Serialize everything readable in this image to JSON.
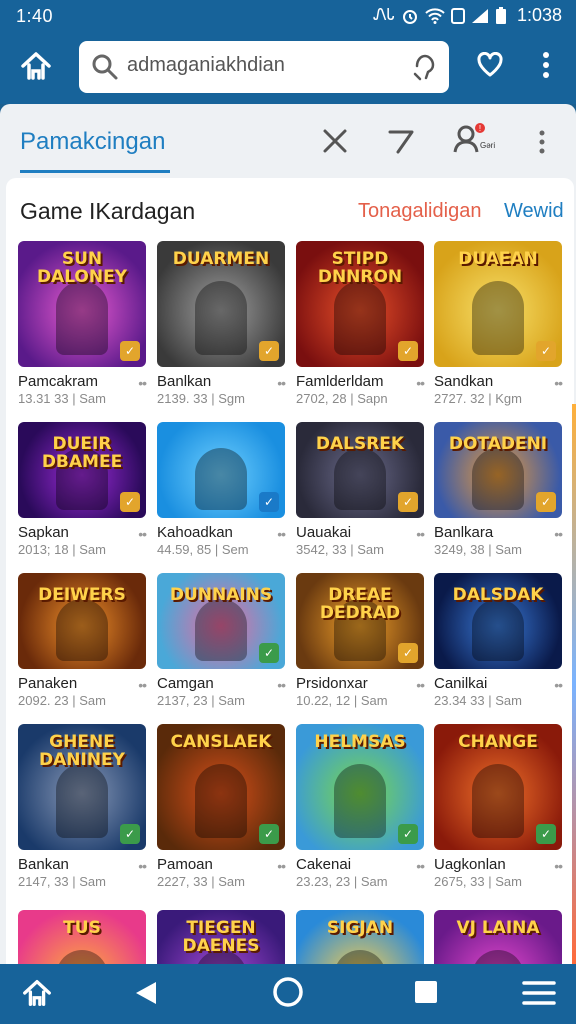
{
  "status_bar": {
    "time": "1:40",
    "carrier": "ᏁᏓ",
    "clock_right": "1:038"
  },
  "search": {
    "value": "admaganiakhdian",
    "placeholder": "admaganiakhdian"
  },
  "tabs": {
    "active_label": "Pamakcingan",
    "profile_caption": "Gəri"
  },
  "section": {
    "title": "Game IKardagan",
    "link_primary": "Tonagalidigan",
    "link_secondary": "Wewid"
  },
  "games": [
    {
      "name": "Pamcakram",
      "meta": "13.31 33 | Sam",
      "logo": "SUN DALONEY",
      "c1": "#5a1a8a",
      "c2": "#e85bd0",
      "badge": "gold"
    },
    {
      "name": "Banlkan",
      "meta": "2139. 33 | Sgm",
      "logo": "DUARMEN",
      "c1": "#3a3a3a",
      "c2": "#a0a0a0",
      "badge": "gold"
    },
    {
      "name": "Famlderldam",
      "meta": "2702, 28 | Sapn",
      "logo": "STIPD DNNRON",
      "c1": "#7a0f0f",
      "c2": "#e8502a",
      "badge": "gold"
    },
    {
      "name": "Sandkan",
      "meta": "2727. 32 | Kgm",
      "logo": "DUAEAN",
      "c1": "#d8a31a",
      "c2": "#f8e06a",
      "badge": "gold"
    },
    {
      "name": "Sapkan",
      "meta": "2013; 18 | Sam",
      "logo": "DUEIR DBAMEE",
      "c1": "#2a0a5a",
      "c2": "#9b2bd8",
      "badge": "gold"
    },
    {
      "name": "Kahoadkan",
      "meta": "44.59, 85 | Sem",
      "logo": "",
      "c1": "#1a8fe0",
      "c2": "#6fd0ff",
      "badge": "blue"
    },
    {
      "name": "Uauakai",
      "meta": "3542, 33 | Sam",
      "logo": "DALSREK",
      "c1": "#2a2a3a",
      "c2": "#6a6a8a",
      "badge": "gold"
    },
    {
      "name": "Banlkara",
      "meta": "3249, 38 | Sam",
      "logo": "DOTADENI",
      "c1": "#3a5aa8",
      "c2": "#e89a3a",
      "badge": "gold"
    },
    {
      "name": "Panaken",
      "meta": "2092. 23 | Sam",
      "logo": "DEIWERS",
      "c1": "#6a2a0a",
      "c2": "#f0902a",
      "badge": "none"
    },
    {
      "name": "Camgan",
      "meta": "2137, 23 | Sam",
      "logo": "DUNNAINS",
      "c1": "#4aa8d8",
      "c2": "#e86aa0",
      "badge": "green"
    },
    {
      "name": "Prsidonxar",
      "meta": "10.22, 12 | Sam",
      "logo": "DREAE DEDRAD",
      "c1": "#6a3a10",
      "c2": "#f0a02a",
      "badge": "gold"
    },
    {
      "name": "Canilkai",
      "meta": "23.34 33 | Sam",
      "logo": "DALSDAK",
      "c1": "#0a1a4a",
      "c2": "#3a7ad8",
      "badge": "none"
    },
    {
      "name": "Bankan",
      "meta": "2147, 33 | Sam",
      "logo": "GHENE DANINEY",
      "c1": "#1a3a6a",
      "c2": "#8a9ab8",
      "badge": "green"
    },
    {
      "name": "Pamoan",
      "meta": "2227, 33 | Sam",
      "logo": "CANSLAEK",
      "c1": "#5a2a0a",
      "c2": "#d8501a",
      "badge": "green"
    },
    {
      "name": "Cakenai",
      "meta": "23.23, 23 | Sam",
      "logo": "HELMSAS",
      "c1": "#3a9ad8",
      "c2": "#7ad84a",
      "badge": "green"
    },
    {
      "name": "Uagkonlan",
      "meta": "2675, 33 | Sam",
      "logo": "CHANGE",
      "c1": "#8a1a0a",
      "c2": "#f0702a",
      "badge": "green"
    },
    {
      "name": "",
      "meta": "",
      "logo": "TUS",
      "c1": "#e83a8a",
      "c2": "#ffb03a",
      "badge": "none"
    },
    {
      "name": "",
      "meta": "",
      "logo": "TIEGEN DAENES",
      "c1": "#3a1a7a",
      "c2": "#a84ad8",
      "badge": "none"
    },
    {
      "name": "",
      "meta": "",
      "logo": "SIGJAN",
      "c1": "#2a8ad8",
      "c2": "#ffd04a",
      "badge": "none"
    },
    {
      "name": "",
      "meta": "",
      "logo": "VJ LAINA",
      "c1": "#6a1a8a",
      "c2": "#e84ad0",
      "badge": "none"
    }
  ]
}
